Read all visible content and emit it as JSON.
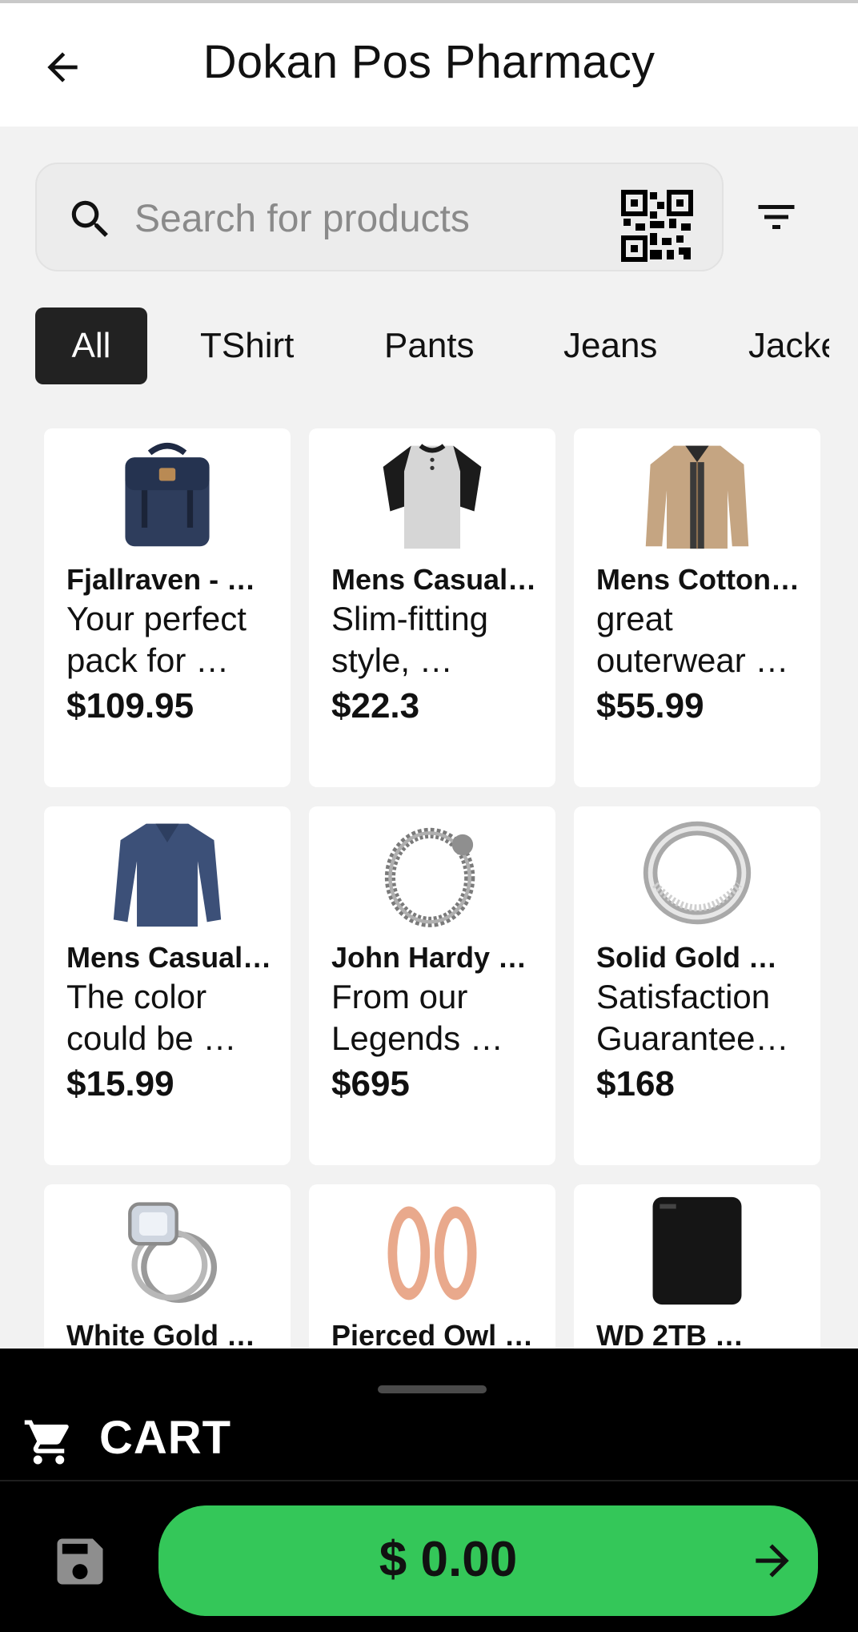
{
  "header": {
    "title": "Dokan Pos Pharmacy",
    "back_icon": "arrow-back-icon"
  },
  "search": {
    "placeholder": "Search for products",
    "value": "",
    "icon": "search-icon",
    "scan_icon": "qr-code-icon"
  },
  "filter": {
    "icon": "filter-icon"
  },
  "categories": [
    {
      "label": "All",
      "active": true
    },
    {
      "label": "TShirt",
      "active": false
    },
    {
      "label": "Pants",
      "active": false
    },
    {
      "label": "Jeans",
      "active": false
    },
    {
      "label": "Jacke",
      "active": false
    }
  ],
  "products": [
    {
      "name": "Fjallraven - …",
      "desc": "Your perfect pack for …",
      "price": "$109.95",
      "image": "backpack"
    },
    {
      "name": "Mens Casual…",
      "desc": "Slim-fitting style, …",
      "price": "$22.3",
      "image": "henley-shirt"
    },
    {
      "name": "Mens Cotton…",
      "desc": "great outerwear …",
      "price": "$55.99",
      "image": "cotton-jacket"
    },
    {
      "name": "Mens Casual…",
      "desc": "The color could be …",
      "price": "$15.99",
      "image": "long-sleeve-tee"
    },
    {
      "name": "John Hardy …",
      "desc": "From our Legends …",
      "price": "$695",
      "image": "dragon-bracelet"
    },
    {
      "name": "Solid Gold …",
      "desc": "Satisfaction Guarantee…",
      "price": "$168",
      "image": "silver-ring"
    },
    {
      "name": "White Gold …",
      "desc": "",
      "price": "",
      "image": "diamond-ring"
    },
    {
      "name": "Pierced Owl …",
      "desc": "",
      "price": "",
      "image": "rose-gold-plugs"
    },
    {
      "name": "WD 2TB …",
      "desc": "",
      "price": "",
      "image": "hard-drive"
    }
  ],
  "cart": {
    "label": "CART",
    "total": "$ 0.00",
    "cart_icon": "cart-icon",
    "save_icon": "save-icon",
    "arrow_icon": "arrow-forward-icon"
  },
  "colors": {
    "accent": "#34c759",
    "active_chip": "#222222",
    "bottom_bar": "#000000",
    "background": "#f2f2f2"
  }
}
